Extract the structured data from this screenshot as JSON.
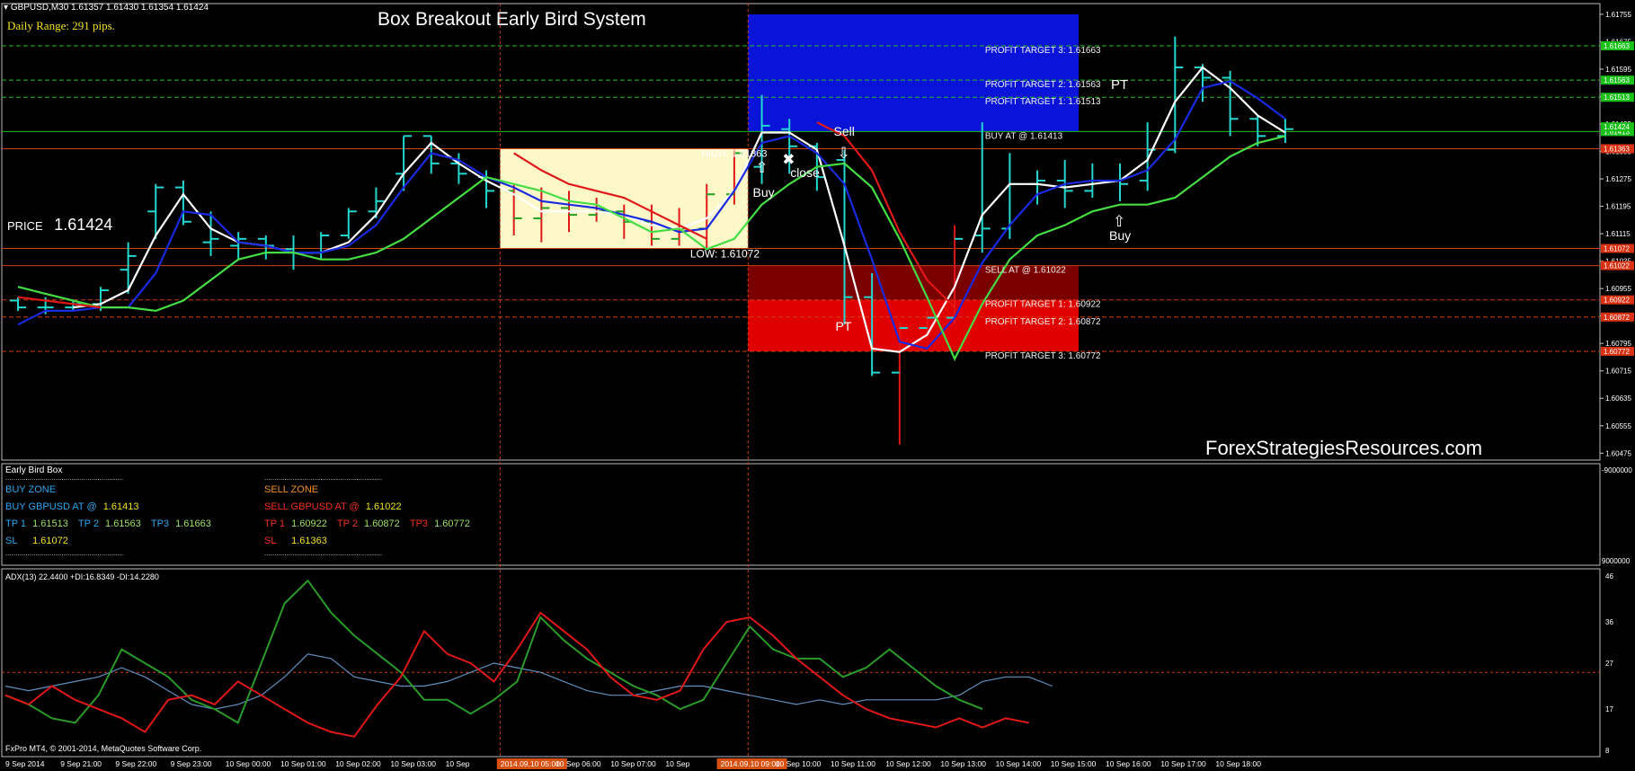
{
  "header": {
    "symbol_line": "GBPUSD,M30  1.61357 1.61430 1.61354 1.61424",
    "daily_range": "Daily Range: 291 pips.",
    "system_title": "Box Breakout Early Bird System",
    "price_label": "PRICE",
    "price_value": "1.61424",
    "watermark": "ForexStrategiesResources.com",
    "copyright": "FxPro MT4, © 2001-2014, MetaQuotes Software Corp."
  },
  "colors": {
    "background": "#000000",
    "buy_zone": "#0a14d8",
    "sell_zone_dark": "#7a0000",
    "sell_zone_bright": "#e00000",
    "box": "#fdf8c8",
    "white_ma": "#ffffff",
    "blue_ma": "#1a2ae0",
    "green_ma": "#44dd44",
    "red_ma": "#e01818",
    "candles": "#22d8d0",
    "adx_line": "#5f8fbf",
    "plus_di": "#2a9a2a",
    "minus_di": "#e01818"
  },
  "chart_data": [
    {
      "type": "line",
      "title": "Box Breakout Early Bird System",
      "y_axis_labels": [
        "1.61755",
        "1.61675",
        "1.61595",
        "1.61515",
        "1.61435",
        "1.61355",
        "1.61275",
        "1.61195",
        "1.61115",
        "1.61035",
        "1.60955",
        "1.60875",
        "1.60795",
        "1.60715",
        "1.60635",
        "1.60555",
        "1.60475"
      ],
      "ylim": [
        1.6046,
        1.6176
      ],
      "level_tags": [
        {
          "value": "1.61663",
          "y": 1.61663,
          "color": "#18c018"
        },
        {
          "value": "1.61563",
          "y": 1.61563,
          "color": "#18c018"
        },
        {
          "value": "1.61513",
          "y": 1.61513,
          "color": "#18c018"
        },
        {
          "value": "1.61413",
          "y": 1.61413,
          "color": "#18c018"
        },
        {
          "value": "1.61363",
          "y": 1.61363,
          "color": "#d83010"
        },
        {
          "value": "1.61072",
          "y": 1.61072,
          "color": "#d83010"
        },
        {
          "value": "1.61022",
          "y": 1.61022,
          "color": "#d83010"
        },
        {
          "value": "1.60922",
          "y": 1.60922,
          "color": "#d83010"
        },
        {
          "value": "1.60872",
          "y": 1.60872,
          "color": "#d83010"
        },
        {
          "value": "1.60772",
          "y": 1.60772,
          "color": "#d83010"
        }
      ],
      "zone_labels": [
        {
          "text": "PROFIT TARGET 3: 1.61663",
          "y": 1.61663
        },
        {
          "text": "PROFIT TARGET 2: 1.61563",
          "y": 1.61563
        },
        {
          "text": "PROFIT TARGET 1: 1.61513",
          "y": 1.61513
        },
        {
          "text": "BUY AT @ 1.61413",
          "y": 1.61413
        },
        {
          "text": "SELL AT @ 1.61022",
          "y": 1.61022
        },
        {
          "text": "PROFIT TARGET 1: 1.60922",
          "y": 1.60922
        },
        {
          "text": "PROFIT TARGET 2: 1.60872",
          "y": 1.60872
        },
        {
          "text": "PROFIT TARGET 3: 1.60772",
          "y": 1.60772
        }
      ],
      "annotations": [
        {
          "text": "HIGH: 1.61363",
          "kind": "box_high"
        },
        {
          "text": "LOW: 1.61072",
          "kind": "box_low"
        },
        {
          "text": "Buy",
          "kind": "signal",
          "bar": 27
        },
        {
          "text": "close",
          "kind": "signal",
          "bar": 28
        },
        {
          "text": "Sell",
          "kind": "signal",
          "bar": 30
        },
        {
          "text": "PT",
          "kind": "signal",
          "bar": 30
        },
        {
          "text": "PT",
          "kind": "signal",
          "bar": 40
        },
        {
          "text": "Buy",
          "kind": "signal",
          "bar": 40
        }
      ],
      "box": {
        "from_bar": 18,
        "to_bar": 26,
        "high": 1.61363,
        "low": 1.61072
      },
      "candles": [
        [
          1.6092,
          1.6093,
          1.6089,
          1.609
        ],
        [
          1.609,
          1.6093,
          1.6088,
          1.609
        ],
        [
          1.609,
          1.6092,
          1.6089,
          1.6091
        ],
        [
          1.6091,
          1.6096,
          1.6089,
          1.6095
        ],
        [
          1.6101,
          1.6109,
          1.6094,
          1.6105
        ],
        [
          1.6118,
          1.6126,
          1.611,
          1.6125
        ],
        [
          1.6125,
          1.6127,
          1.6114,
          1.6115
        ],
        [
          1.6109,
          1.6118,
          1.6105,
          1.611
        ],
        [
          1.6108,
          1.6112,
          1.6104,
          1.611
        ],
        [
          1.611,
          1.6111,
          1.6104,
          1.6108
        ],
        [
          1.6107,
          1.6111,
          1.6101,
          1.6106
        ],
        [
          1.6106,
          1.6112,
          1.6104,
          1.6111
        ],
        [
          1.6111,
          1.6119,
          1.611,
          1.6118
        ],
        [
          1.6118,
          1.6125,
          1.6116,
          1.6121
        ],
        [
          1.6129,
          1.614,
          1.6124,
          1.614
        ],
        [
          1.614,
          1.614,
          1.6129,
          1.6132
        ],
        [
          1.6132,
          1.6135,
          1.6126,
          1.6129
        ],
        [
          1.6128,
          1.613,
          1.6119,
          1.6124
        ],
        [
          1.6124,
          1.6126,
          1.6111,
          1.6116
        ],
        [
          1.6116,
          1.6125,
          1.6109,
          1.6119
        ],
        [
          1.6119,
          1.6124,
          1.6112,
          1.6117
        ],
        [
          1.6117,
          1.6122,
          1.6115,
          1.6118
        ],
        [
          1.6118,
          1.612,
          1.611,
          1.6115
        ],
        [
          1.6115,
          1.612,
          1.6108,
          1.611
        ],
        [
          1.611,
          1.6119,
          1.6108,
          1.6113
        ],
        [
          1.6113,
          1.6126,
          1.6107,
          1.6123
        ],
        [
          1.6123,
          1.6136,
          1.612,
          1.6135
        ],
        [
          1.6131,
          1.6152,
          1.6126,
          1.6143
        ],
        [
          1.6142,
          1.6145,
          1.6129,
          1.6137
        ],
        [
          1.6137,
          1.6138,
          1.6124,
          1.6128
        ],
        [
          1.6133,
          1.6136,
          1.6085,
          1.6093
        ],
        [
          1.6093,
          1.61,
          1.607,
          1.6071
        ],
        [
          1.6071,
          1.6086,
          1.605,
          1.6084
        ],
        [
          1.6084,
          1.6089,
          1.6081,
          1.6087
        ],
        [
          1.6087,
          1.6114,
          1.6085,
          1.611
        ],
        [
          1.6111,
          1.6144,
          1.6106,
          1.6113
        ],
        [
          1.6113,
          1.6135,
          1.611,
          1.6126
        ],
        [
          1.6126,
          1.613,
          1.612,
          1.6127
        ],
        [
          1.6127,
          1.6133,
          1.6119,
          1.6124
        ],
        [
          1.6124,
          1.6132,
          1.6122,
          1.6127
        ],
        [
          1.6127,
          1.6132,
          1.6121,
          1.6126
        ],
        [
          1.6127,
          1.6144,
          1.6124,
          1.6136
        ],
        [
          1.6136,
          1.6169,
          1.6135,
          1.616
        ],
        [
          1.616,
          1.6161,
          1.615,
          1.6157
        ],
        [
          1.6157,
          1.6159,
          1.614,
          1.6145
        ],
        [
          1.6145,
          1.6146,
          1.6137,
          1.614
        ],
        [
          1.614,
          1.6145,
          1.6138,
          1.6142
        ]
      ],
      "series": [
        {
          "color": "#ffffff",
          "values": [
            null,
            null,
            1.609,
            1.6091,
            1.6095,
            1.6111,
            1.6123,
            1.6113,
            1.6109,
            1.6108,
            1.6106,
            1.6106,
            1.6109,
            1.6117,
            1.6129,
            1.6138,
            1.6132,
            1.6127,
            1.6123,
            1.6118,
            1.6118,
            1.6118,
            1.6117,
            1.6114,
            1.6113,
            1.6116,
            1.6124,
            1.6141,
            1.6141,
            1.6136,
            1.6108,
            1.6078,
            1.6077,
            1.6082,
            1.6096,
            1.6117,
            1.6126,
            1.6126,
            1.6125,
            1.6126,
            1.6127,
            1.6133,
            1.615,
            1.616,
            1.6154,
            1.6146,
            1.6141
          ]
        },
        {
          "color": "#1a2ae0",
          "values": [
            1.6085,
            1.6089,
            1.6089,
            1.609,
            1.609,
            1.61,
            1.6118,
            1.6117,
            1.6109,
            1.6108,
            1.6106,
            1.6106,
            1.6108,
            1.6114,
            1.6125,
            1.6135,
            1.6133,
            1.6128,
            1.6125,
            1.6121,
            1.612,
            1.6119,
            1.6117,
            1.6115,
            1.6112,
            1.6113,
            1.6124,
            1.6138,
            1.614,
            1.6135,
            1.6126,
            1.6104,
            1.608,
            1.6078,
            1.6087,
            1.6103,
            1.6114,
            1.6123,
            1.6126,
            1.6127,
            1.6127,
            1.613,
            1.6139,
            1.6154,
            1.6156,
            1.6151,
            1.6145
          ]
        },
        {
          "color": "#44dd44",
          "values": [
            1.6096,
            1.6094,
            1.6092,
            1.609,
            1.609,
            1.6089,
            1.6092,
            1.6098,
            1.6104,
            1.6106,
            1.6106,
            1.6104,
            1.6104,
            1.6106,
            1.611,
            1.6116,
            1.6122,
            1.6128,
            1.6126,
            1.6124,
            1.6121,
            1.612,
            1.6116,
            1.6112,
            1.6113,
            1.6107,
            1.611,
            1.612,
            1.6126,
            1.6131,
            1.6132,
            1.6125,
            1.611,
            1.6093,
            1.6075,
            1.6091,
            1.6104,
            1.6111,
            1.6114,
            1.6118,
            1.612,
            1.612,
            1.6122,
            1.6128,
            1.6134,
            1.6138,
            1.614
          ]
        },
        {
          "color": "#e01818",
          "values": [
            1.6093,
            1.6092,
            1.6091,
            1.609,
            null,
            null,
            null,
            null,
            null,
            null,
            null,
            null,
            null,
            null,
            null,
            null,
            null,
            null,
            1.6135,
            1.613,
            1.6126,
            1.6124,
            1.6122,
            1.6118,
            1.6114,
            1.611,
            null,
            null,
            null,
            1.6144,
            1.614,
            1.613,
            1.6112,
            1.6098,
            1.609,
            null,
            null,
            null,
            null,
            null,
            null,
            null,
            null,
            null,
            null,
            null,
            null
          ]
        }
      ]
    },
    {
      "type": "line",
      "title": "ADX(13) 22.4400 +DI:16.8349 -DI:14.2280",
      "y_axis_labels": [
        "46",
        "36",
        "27",
        "17",
        "8"
      ],
      "ylim": [
        8,
        46
      ],
      "series": [
        {
          "name": "ADX(13)",
          "color": "#5f8fbf",
          "values": [
            22,
            21,
            22,
            23,
            24,
            26,
            24,
            21,
            18,
            17,
            18,
            20,
            24,
            29,
            28,
            24,
            23,
            22,
            22,
            23,
            25,
            27,
            26,
            25,
            23,
            21,
            20,
            20,
            21,
            22,
            22,
            21,
            20,
            19,
            18,
            19,
            18,
            19,
            19,
            19,
            19,
            20,
            23,
            24,
            24,
            22
          ]
        },
        {
          "name": "+DI",
          "color": "#2a9a2a",
          "values": [
            20,
            18,
            15,
            14,
            20,
            30,
            27,
            24,
            19,
            17,
            14,
            27,
            40,
            45,
            38,
            33,
            29,
            25,
            19,
            19,
            16,
            19,
            23,
            37,
            32,
            28,
            25,
            22,
            20,
            17,
            19,
            27,
            35,
            30,
            28,
            28,
            24,
            26,
            30,
            26,
            22,
            19,
            17,
            null,
            null,
            null
          ]
        },
        {
          "name": "-DI",
          "color": "#e01818",
          "values": [
            20,
            18,
            22,
            19,
            17,
            15,
            12,
            19,
            20,
            18,
            23,
            20,
            17,
            14,
            12,
            11,
            18,
            24,
            34,
            29,
            27,
            23,
            30,
            38,
            34,
            30,
            24,
            20,
            19,
            21,
            30,
            36,
            37,
            33,
            28,
            24,
            20,
            17,
            15,
            14,
            13,
            15,
            13,
            15,
            14,
            null
          ]
        }
      ],
      "reference_lines": [
        25
      ]
    }
  ],
  "indicator": {
    "panel_title": "Early Bird Box",
    "buy": {
      "zone": "BUY ZONE",
      "entry_label": "BUY GBPUSD AT @",
      "entry_value": "1.61413",
      "tp1_label": "TP 1",
      "tp1_value": "1.61513",
      "tp2_label": "TP 2",
      "tp2_value": "1.61563",
      "tp3_label": "TP3",
      "tp3_value": "1.61663",
      "sl_label": "SL",
      "sl_value": "1.61072"
    },
    "sell": {
      "zone": "SELL ZONE",
      "entry_label": "SELL GBPUSD AT @",
      "entry_value": "1.61022",
      "tp1_label": "TP 1",
      "tp1_value": "1.60922",
      "tp2_label": "TP 2",
      "tp2_value": "1.60872",
      "tp3_label": "TP3",
      "tp3_value": "1.60772",
      "sl_label": "SL",
      "sl_value": "1.61363"
    },
    "separator": "...........................................................",
    "scale_top": "-9000000",
    "scale_bottom": "9000000"
  },
  "time_axis": [
    {
      "label": "9 Sep 2014",
      "highlight": false
    },
    {
      "label": "9 Sep 21:00",
      "highlight": false
    },
    {
      "label": "9 Sep 22:00",
      "highlight": false
    },
    {
      "label": "9 Sep 23:00",
      "highlight": false
    },
    {
      "label": "10 Sep 00:00",
      "highlight": false
    },
    {
      "label": "10 Sep 01:00",
      "highlight": false
    },
    {
      "label": "10 Sep 02:00",
      "highlight": false
    },
    {
      "label": "10 Sep 03:00",
      "highlight": false
    },
    {
      "label": "10 Sep",
      "highlight": false
    },
    {
      "label": "2014.09.10 05:00",
      "highlight": true
    },
    {
      "label": "10 Sep 06:00",
      "highlight": false
    },
    {
      "label": "10 Sep 07:00",
      "highlight": false
    },
    {
      "label": "10 Sep",
      "highlight": false
    },
    {
      "label": "2014.09.10 09:00",
      "highlight": true
    },
    {
      "label": "10 Sep 10:00",
      "highlight": false
    },
    {
      "label": "10 Sep 11:00",
      "highlight": false
    },
    {
      "label": "10 Sep 12:00",
      "highlight": false
    },
    {
      "label": "10 Sep 13:00",
      "highlight": false
    },
    {
      "label": "10 Sep 14:00",
      "highlight": false
    },
    {
      "label": "10 Sep 15:00",
      "highlight": false
    },
    {
      "label": "10 Sep 16:00",
      "highlight": false
    },
    {
      "label": "10 Sep 17:00",
      "highlight": false
    },
    {
      "label": "10 Sep 18:00",
      "highlight": false
    }
  ]
}
